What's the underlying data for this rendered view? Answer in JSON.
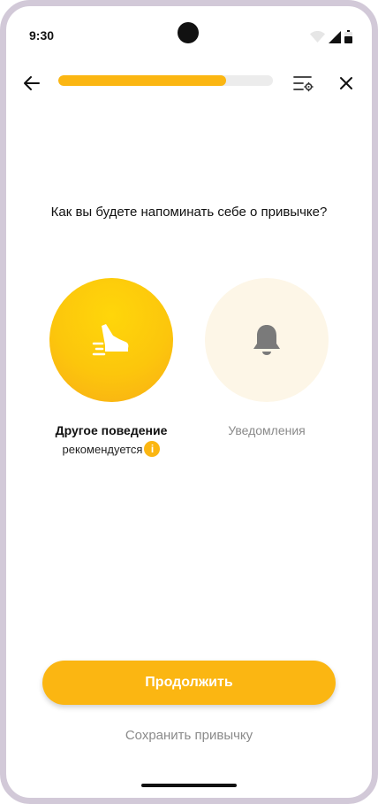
{
  "status_bar": {
    "time": "9:30",
    "icons": [
      "wifi-icon",
      "signal-icon",
      "battery-icon"
    ]
  },
  "toolbar": {
    "back_icon": "arrow-left-icon",
    "progress": 0.78,
    "settings_icon": "sliders-gear-icon",
    "close_icon": "close-icon"
  },
  "main": {
    "question": "Как вы будете напоминать себе о привычке?",
    "options": [
      {
        "label": "Другое поведение",
        "sublabel": "рекомендуется",
        "icon": "shoe-icon",
        "info_icon": "info-icon",
        "selected": true
      },
      {
        "label": "Уведомления",
        "icon": "bell-icon",
        "selected": false
      }
    ]
  },
  "actions": {
    "continue_label": "Продолжить",
    "save_label": "Сохранить привычку"
  },
  "colors": {
    "accent": "#fbb612",
    "accent_light": "#ffd60a",
    "inactive_bg": "#fdf6e7",
    "muted_text": "#8a8a8a",
    "frame": "#d2c9d8"
  }
}
